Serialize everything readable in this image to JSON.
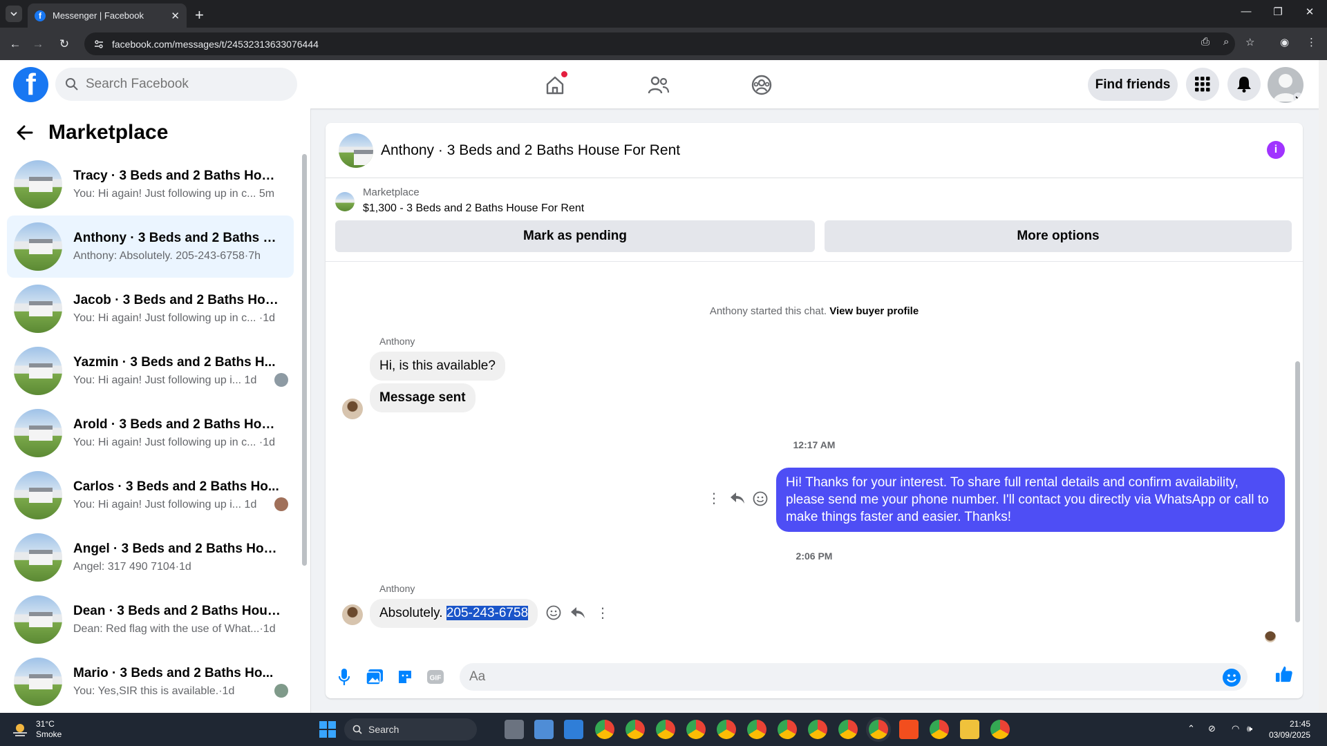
{
  "browser": {
    "tab_title": "Messenger | Facebook",
    "url": "facebook.com/messages/t/24532313633076444",
    "new_tab_label": "+",
    "close_label": "✕"
  },
  "header": {
    "logo_text": "f",
    "search_placeholder": "Search Facebook",
    "find_friends_label": "Find friends"
  },
  "left_panel": {
    "title": "Marketplace",
    "conversations": [
      {
        "name": "Tracy · 3 Beds and 2 Baths House...",
        "snippet": "You: Hi again! Just following up in c... 5m"
      },
      {
        "name": "Anthony · 3 Beds and 2 Baths Ho...",
        "snippet": "Anthony: Absolutely. 205-243-6758·7h"
      },
      {
        "name": "Jacob · 3 Beds and 2 Baths Hous...",
        "snippet": "You: Hi again! Just following up in c... ·1d"
      },
      {
        "name": "Yazmin · 3 Beds and 2 Baths H...",
        "snippet": "You: Hi again! Just following up i...    1d"
      },
      {
        "name": "Arold · 3 Beds and 2 Baths Hous...",
        "snippet": "You: Hi again! Just following up in c... ·1d"
      },
      {
        "name": "Carlos · 3 Beds and 2 Baths Ho...",
        "snippet": "You: Hi again! Just following up i...    1d"
      },
      {
        "name": "Angel · 3 Beds and 2 Baths Hous...",
        "snippet": "Angel: 317 490 7104·1d"
      },
      {
        "name": "Dean · 3 Beds and 2 Baths House...",
        "snippet": "Dean: Red flag with the use of What...·1d"
      },
      {
        "name": "Mario · 3 Beds and 2 Baths Ho...",
        "snippet": "You: Yes,SIR this is available.·1d"
      }
    ]
  },
  "chat": {
    "title": "Anthony · 3 Beds and 2 Baths House For Rent",
    "info_label": "i",
    "marketplace_label": "Marketplace",
    "listing": "$1,300 - 3 Beds and 2 Baths House For Rent",
    "mark_pending_label": "Mark as pending",
    "more_options_label": "More options",
    "started_note": "Anthony started this chat.",
    "view_profile_label": "View buyer profile",
    "sender_name_1": "Anthony",
    "msg_available": "Hi, is this available?",
    "msg_sent": "Message sent",
    "time_1": "12:17 AM",
    "msg_out": "Hi! Thanks for your interest. To share full rental details and confirm availability, please send me your phone number. I'll contact you directly via WhatsApp or call to make things faster and easier. Thanks!",
    "time_2": "2:06 PM",
    "sender_name_2": "Anthony",
    "msg_reply_prefix": "Absolutely.",
    "msg_reply_phone": "205-243-6758",
    "composer_placeholder": "Aa"
  },
  "taskbar": {
    "temp": "31°C",
    "condition": "Smoke",
    "search_label": "Search",
    "time": "21:45",
    "date": "03/09/2025"
  },
  "colors": {
    "fb_blue": "#1877f2",
    "outgoing_bubble": "#4e4ef5",
    "info_purple": "#a033ff"
  }
}
